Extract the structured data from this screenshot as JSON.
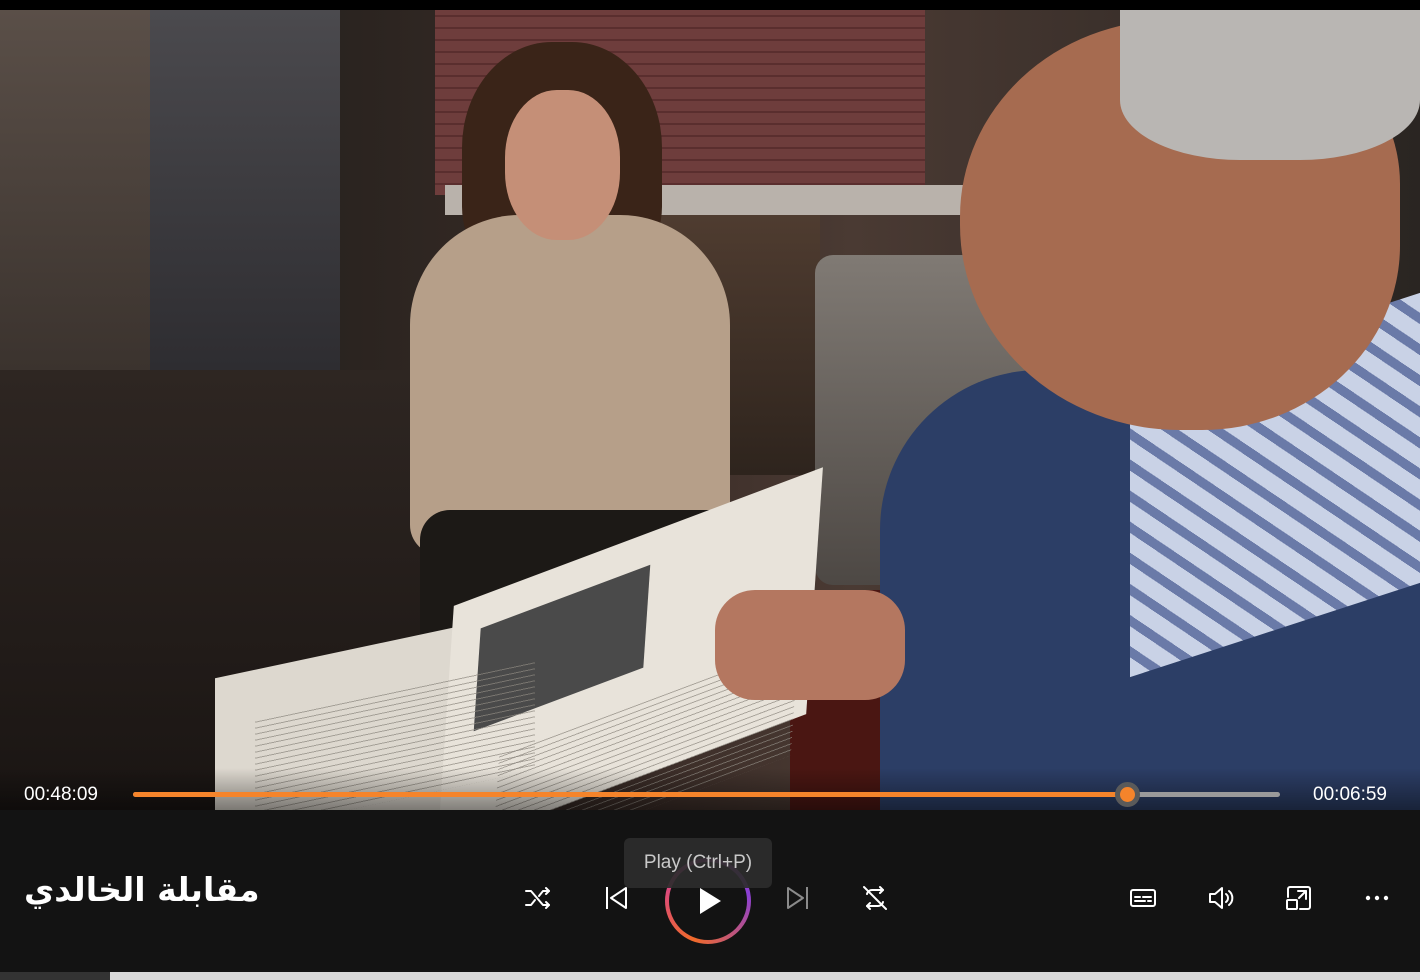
{
  "player": {
    "media_title": "مقابلة الخالدي",
    "time_elapsed": "00:48:09",
    "time_remaining": "00:06:59",
    "progress_fraction": 0.867
  },
  "tooltip": {
    "text": "Play (Ctrl+P)"
  },
  "controls": {
    "shuffle_icon": "shuffle-icon",
    "previous_icon": "skip-previous-icon",
    "play_icon": "play-icon",
    "next_icon": "skip-next-icon",
    "repeat_icon": "repeat-off-icon",
    "captions_icon": "captions-icon",
    "volume_icon": "volume-icon",
    "miniplayer_icon": "mini-player-icon",
    "more_icon": "more-options-icon"
  },
  "colors": {
    "accent": "#f5842b",
    "control_bar": "#131313",
    "track": "#9a9a9a"
  }
}
